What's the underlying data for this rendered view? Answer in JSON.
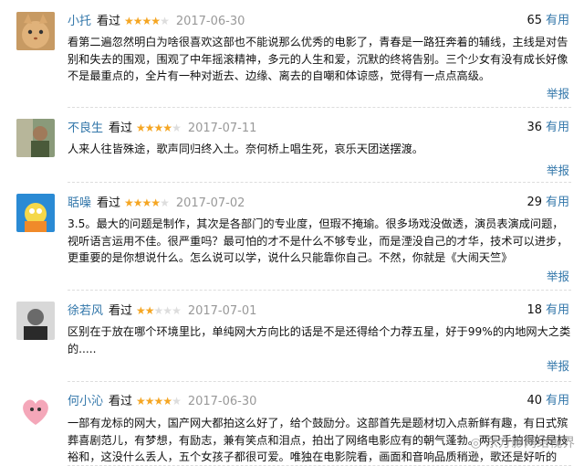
{
  "reviews": [
    {
      "user": "小托",
      "watched": "看过",
      "rating": 4,
      "date": "2017-06-30",
      "useful_count": "65",
      "useful_label": "有用",
      "text": "看第二遍忽然明白为啥很喜欢这部也不能说那么优秀的电影了，青春是一路狂奔着的辅线，主线是对告别和失去的围观，围观了中年摇滚精神，多元的人生和爱，沉默的终将告别。三个少女有没有成长好像不是最重点的，全片有一种对逝去、边缘、离去的自嘲和体谅感，觉得有一点点高级。",
      "report": "举报"
    },
    {
      "user": "不良生",
      "watched": "看过",
      "rating": 4,
      "date": "2017-07-11",
      "useful_count": "36",
      "useful_label": "有用",
      "text": "人来人往皆殊途，歌声同归终入土。奈何桥上唱生死，哀乐天团送摆渡。",
      "report": "举报"
    },
    {
      "user": "聒噪",
      "watched": "看过",
      "rating": 4,
      "date": "2017-07-02",
      "useful_count": "29",
      "useful_label": "有用",
      "text": "3.5。最大的问题是制作，其次是各部门的专业度，但瑕不掩瑜。很多场戏没做透，演员表演成问题，视听语言运用不佳。很严重吗？最可怕的才不是什么不够专业，而是湮没自己的才华，技术可以进步，更重要的是你想说什么。怎么说可以学，说什么只能靠你自己。不然，你就是《大闹天竺》",
      "report": "举报"
    },
    {
      "user": "徐若风",
      "watched": "看过",
      "rating": 2,
      "date": "2017-07-01",
      "useful_count": "18",
      "useful_label": "有用",
      "text": "区别在于放在哪个环境里比，单纯网大方向比的话是不是还得给个力荐五星，好于99%的内地网大之类的.....",
      "report": "举报"
    },
    {
      "user": "何小沁",
      "watched": "看过",
      "rating": 4,
      "date": "2017-06-30",
      "useful_count": "40",
      "useful_label": "有用",
      "text": "一部有龙标的网大，国产网大都拍这么好了，给个鼓励分。这部首先是题材切入点新鲜有趣，有日式殡葬喜剧范儿，有梦想，有励志，兼有笑点和泪点，拍出了网络电影应有的朝气蓬勃。两只手拍得好是枝裕和，这没什么丢人，五个女孩子都很可爱。唯独在电影院看，画面和音响品质稍逊，歌还是好听的",
      "report": ""
    }
  ],
  "watermark": "◎ 东方影网络视界",
  "colors": {
    "link": "#3377aa",
    "star": "#f5a623",
    "date": "#999999"
  }
}
